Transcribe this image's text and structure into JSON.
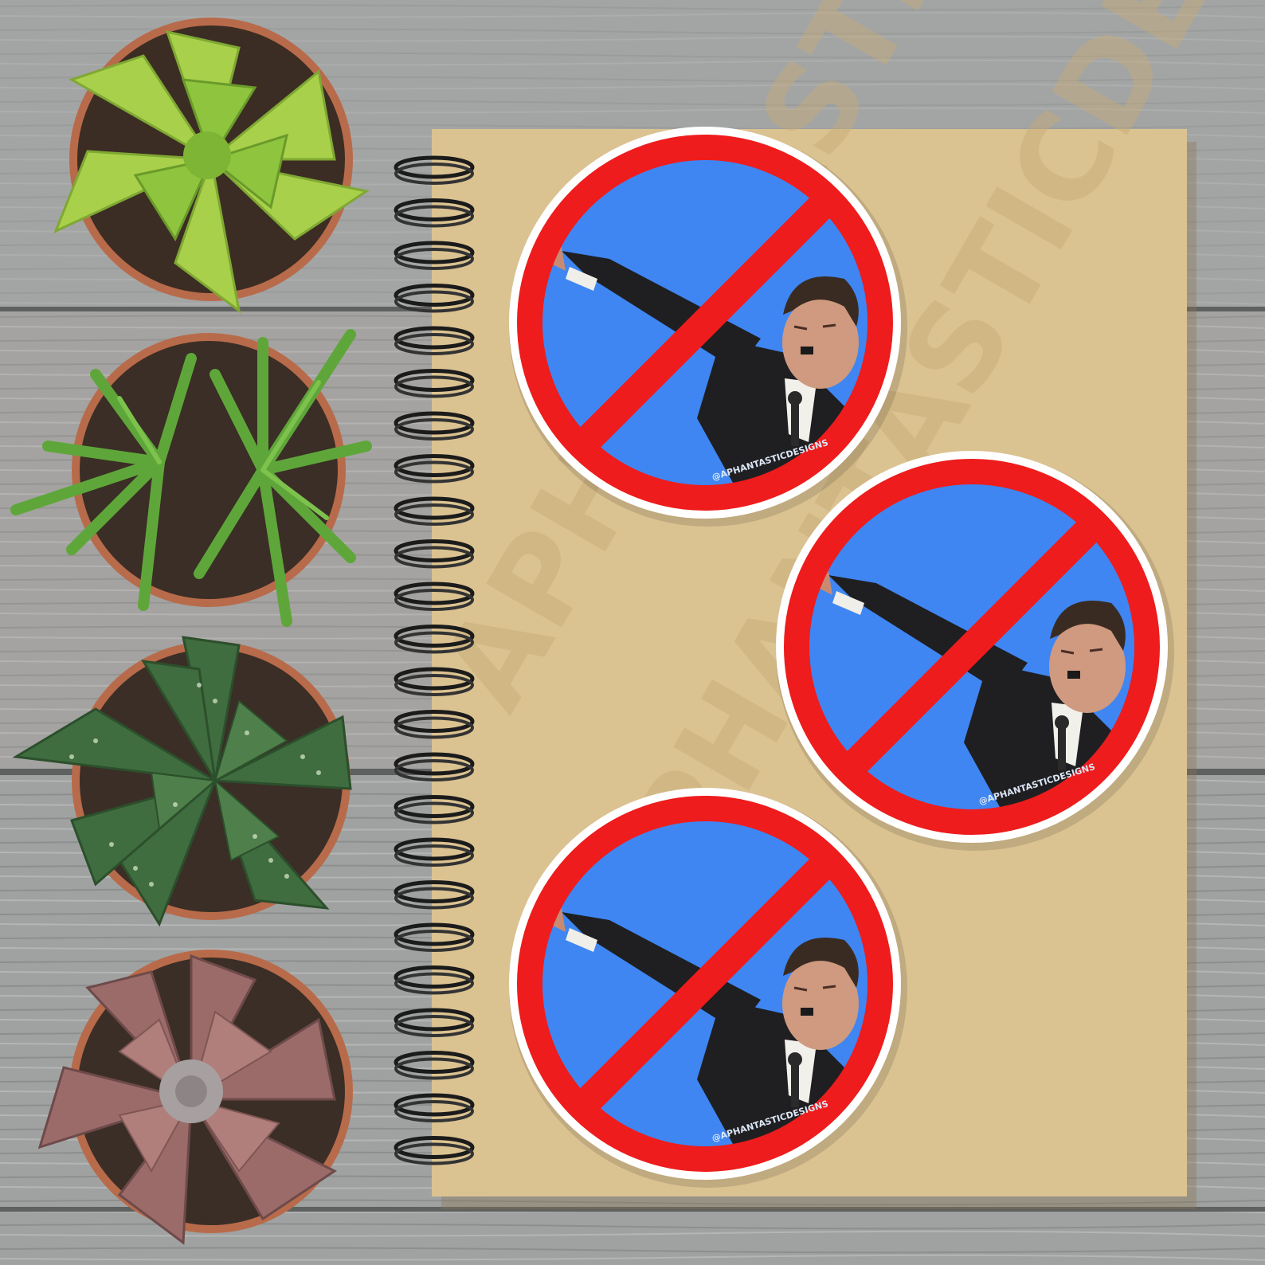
{
  "scene": {
    "description_free": true,
    "wood_color": "#a3a5a5",
    "wood_dark": "#6f7171",
    "notebook_color": "#d9bf8c",
    "spiral_color": "#1b1b1b"
  },
  "watermark": {
    "text": "APHANTASTICDESIGNS",
    "color": "#c9ae79"
  },
  "stickers": [
    {
      "credit": "@APHANTASTICDESIGNS"
    },
    {
      "credit": "@APHANTASTICDESIGNS"
    },
    {
      "credit": "@APHANTASTICDESIGNS"
    }
  ],
  "sticker_colors": {
    "border": "#ffffff",
    "ring": "#ee1c1c",
    "sky": "#3f86f2",
    "suit": "#1f1f22"
  },
  "plants": [
    {
      "name": "light-green-succulent-icon",
      "color": "#a8d04a"
    },
    {
      "name": "spiky-green-plant-icon",
      "color": "#5fa63a"
    },
    {
      "name": "spotted-aloe-icon",
      "color": "#3e6b3e"
    },
    {
      "name": "pink-echeveria-icon",
      "color": "#9a6a6a"
    }
  ]
}
